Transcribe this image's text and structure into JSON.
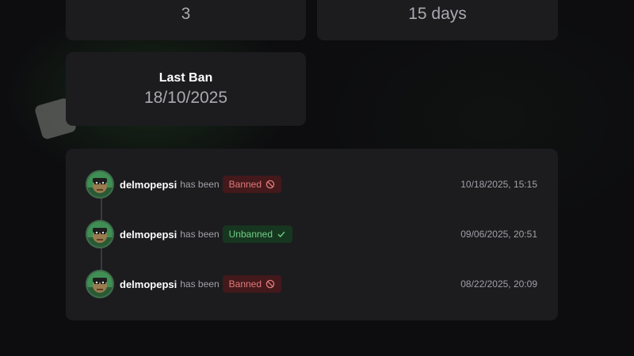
{
  "stats": {
    "top_left_value": "3",
    "top_right_value": "15 days",
    "last_ban": {
      "title": "Last Ban",
      "value": "18/10/2025"
    }
  },
  "history": {
    "entries": [
      {
        "username": "delmopepsi",
        "action_text": "has been",
        "status": "Banned",
        "status_icon": "ban-icon",
        "status_color": "#e07a7a",
        "timestamp": "10/18/2025, 15:15"
      },
      {
        "username": "delmopepsi",
        "action_text": "has been",
        "status": "Unbanned",
        "status_icon": "check-icon",
        "status_color": "#6fd188",
        "timestamp": "09/06/2025, 20:51"
      },
      {
        "username": "delmopepsi",
        "action_text": "has been",
        "status": "Banned",
        "status_icon": "ban-icon",
        "status_color": "#e07a7a",
        "timestamp": "08/22/2025, 20:09"
      }
    ]
  }
}
